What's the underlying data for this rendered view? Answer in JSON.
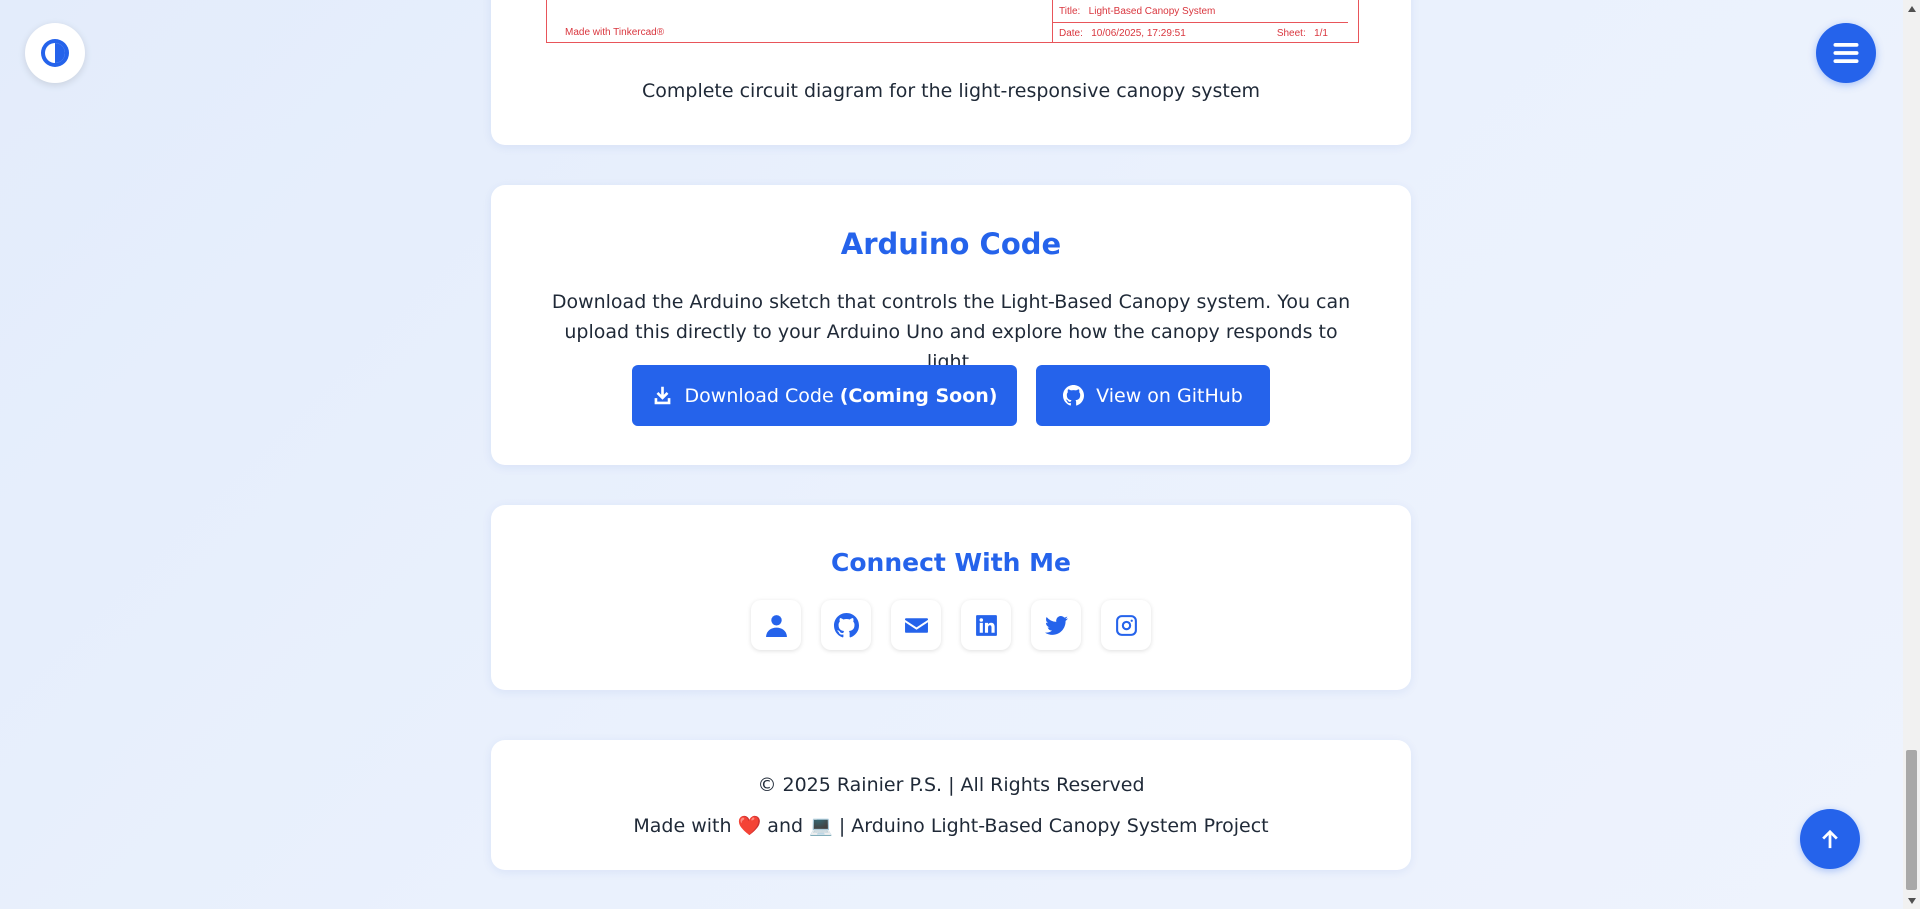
{
  "diagram": {
    "made_with": "Made with Tinkercad®",
    "title_label": "Title:",
    "title_value": "Light-Based Canopy System",
    "date_label": "Date:",
    "date_value": "10/06/2025, 17:29:51",
    "sheet_label": "Sheet:",
    "sheet_value": "1/1",
    "caption": "Complete circuit diagram for the light-responsive canopy system"
  },
  "arduino": {
    "title": "Arduino Code",
    "description": "Download the Arduino sketch that controls the Light-Based Canopy system. You can upload this directly to your Arduino Uno and explore how the canopy responds to light.",
    "download_label": "Download Code",
    "download_badge": "(Coming Soon)",
    "download_icon": "download-icon",
    "github_label": "View on GitHub",
    "github_icon": "github-icon"
  },
  "connect": {
    "title": "Connect With Me",
    "links": [
      {
        "icon": "user-icon"
      },
      {
        "icon": "github-icon"
      },
      {
        "icon": "email-icon"
      },
      {
        "icon": "linkedin-icon"
      },
      {
        "icon": "twitter-icon"
      },
      {
        "icon": "instagram-icon"
      }
    ]
  },
  "footer": {
    "copyright": "© 2025 Rainier P.S. | All Rights Reserved",
    "made_with": "Made with",
    "heart": "❤️",
    "and": "and",
    "laptop": "💻",
    "project": "| Arduino Light-Based Canopy System Project"
  },
  "floating": {
    "theme_icon": "contrast-icon",
    "menu_icon": "hamburger-menu-icon",
    "top_icon": "arrow-up-icon"
  },
  "colors": {
    "accent": "#2563eb",
    "schematic_red": "#d9363e",
    "heart": "#f43f5e"
  }
}
